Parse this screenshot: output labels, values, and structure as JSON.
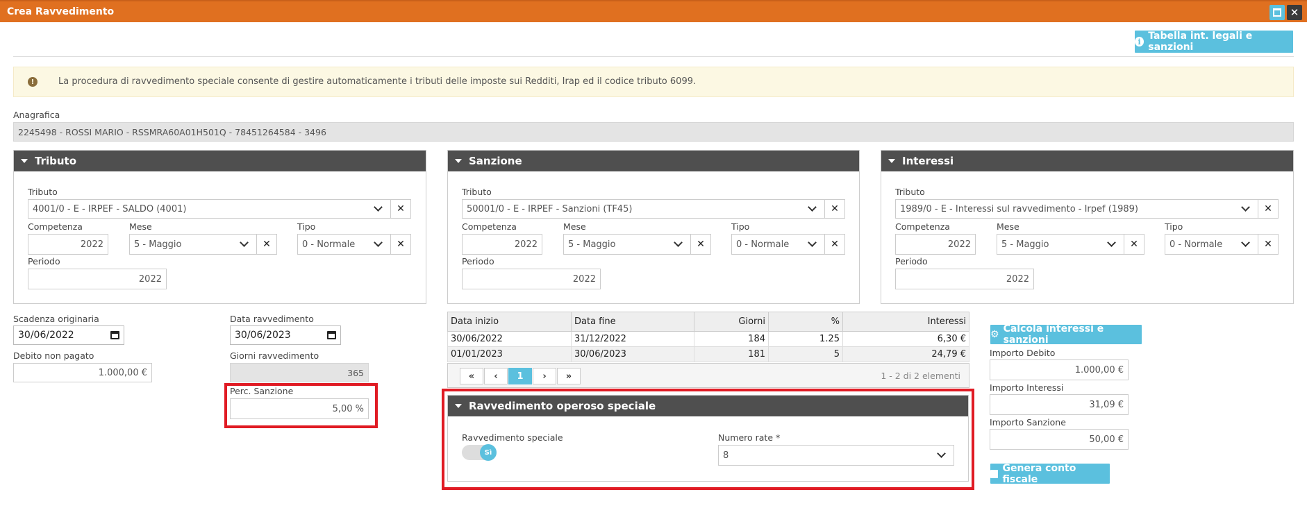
{
  "window": {
    "title": "Crea Ravvedimento"
  },
  "toolbar": {
    "tabella_label": "Tabella int. legali e sanzioni"
  },
  "alert": {
    "text": "La procedura di ravvedimento speciale consente di gestire automaticamente i tributi delle imposte sui Redditi, Irap ed il codice tributo 6099."
  },
  "anagrafica": {
    "label": "Anagrafica",
    "value": "2245498 - ROSSI MARIO - RSSMRA60A01H501Q - 78451264584 - 3496"
  },
  "panels": [
    {
      "title": "Tributo",
      "tributo_label": "Tributo",
      "tributo_value": "4001/0 - E - IRPEF - SALDO (4001)",
      "competenza_label": "Competenza",
      "competenza_value": "2022",
      "mese_label": "Mese",
      "mese_value": "5 - Maggio",
      "tipo_label": "Tipo",
      "tipo_value": "0 - Normale",
      "periodo_label": "Periodo",
      "periodo_value": "2022"
    },
    {
      "title": "Sanzione",
      "tributo_label": "Tributo",
      "tributo_value": "50001/0 - E - IRPEF - Sanzioni (TF45)",
      "competenza_label": "Competenza",
      "competenza_value": "2022",
      "mese_label": "Mese",
      "mese_value": "5 - Maggio",
      "tipo_label": "Tipo",
      "tipo_value": "0 - Normale",
      "periodo_label": "Periodo",
      "periodo_value": "2022"
    },
    {
      "title": "Interessi",
      "tributo_label": "Tributo",
      "tributo_value": "1989/0 - E - Interessi sul ravvedimento - Irpef (1989)",
      "competenza_label": "Competenza",
      "competenza_value": "2022",
      "mese_label": "Mese",
      "mese_value": "5 - Maggio",
      "tipo_label": "Tipo",
      "tipo_value": "0 - Normale",
      "periodo_label": "Periodo",
      "periodo_value": "2022"
    }
  ],
  "form": {
    "scadenza_label": "Scadenza originaria",
    "scadenza_value": "30/06/2022",
    "data_ravv_label": "Data ravvedimento",
    "data_ravv_value": "30/06/2023",
    "debito_label": "Debito non pagato",
    "debito_value": "1.000,00 €",
    "giorni_label": "Giorni ravvedimento",
    "giorni_value": "365",
    "perc_label": "Perc. Sanzione",
    "perc_value": "5,00 %"
  },
  "table": {
    "headers": [
      "Data inizio",
      "Data fine",
      "Giorni",
      "%",
      "Interessi"
    ],
    "rows": [
      [
        "30/06/2022",
        "31/12/2022",
        "184",
        "1.25",
        "6,30 €"
      ],
      [
        "01/01/2023",
        "30/06/2023",
        "181",
        "5",
        "24,79 €"
      ]
    ],
    "pager": {
      "first": "«",
      "prev": "‹",
      "page": "1",
      "next": "›",
      "last": "»",
      "info": "1 - 2 di 2 elementi"
    }
  },
  "speciale": {
    "title": "Ravvedimento operoso speciale",
    "toggle_label": "Ravvedimento speciale",
    "toggle_value": "Sì",
    "rate_label": "Numero rate *",
    "rate_value": "8"
  },
  "right": {
    "calcola_label": "Calcola interessi e sanzioni",
    "debito_label": "Importo Debito",
    "debito_value": "1.000,00 €",
    "interessi_label": "Importo Interessi",
    "interessi_value": "31,09 €",
    "sanzione_label": "Importo Sanzione",
    "sanzione_value": "50,00 €",
    "genera_label": "Genera conto fiscale"
  },
  "colors": {
    "titlebar": "#e07020",
    "accent": "#5bc0de",
    "panel_header": "#4f4f4f",
    "highlight": "#e01b24"
  }
}
